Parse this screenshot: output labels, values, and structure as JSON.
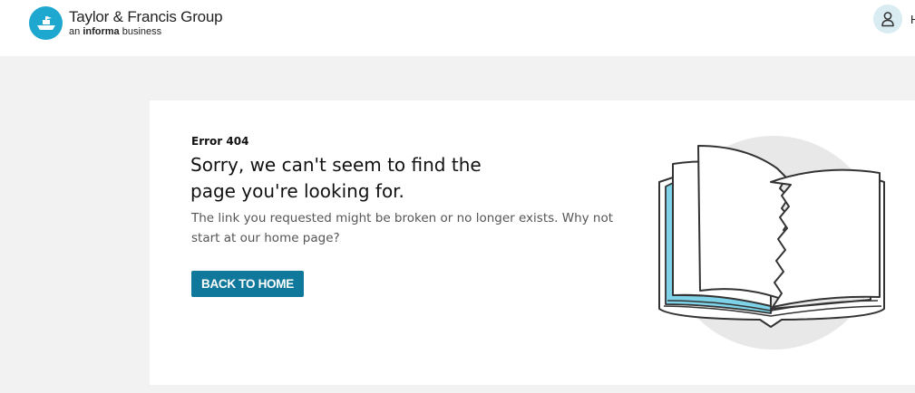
{
  "header": {
    "logo": {
      "name": "Taylor & Francis Group",
      "tagline_prefix": "an",
      "tagline_bold": "informa",
      "tagline_suffix": "business",
      "icon": "ship-logo-icon",
      "color": "#1ea7cf"
    },
    "account": {
      "icon": "user-icon",
      "label": "H"
    }
  },
  "error": {
    "code": "Error 404",
    "headline": "Sorry, we can't seem to find the page you're looking for.",
    "message": "The link you requested might be broken or no longer exists. Why not start at our home page?",
    "button_label": "BACK TO HOME",
    "button_color": "#10789b"
  },
  "illustration": {
    "icon": "torn-book-icon",
    "accent_color": "#7fd3e8"
  }
}
